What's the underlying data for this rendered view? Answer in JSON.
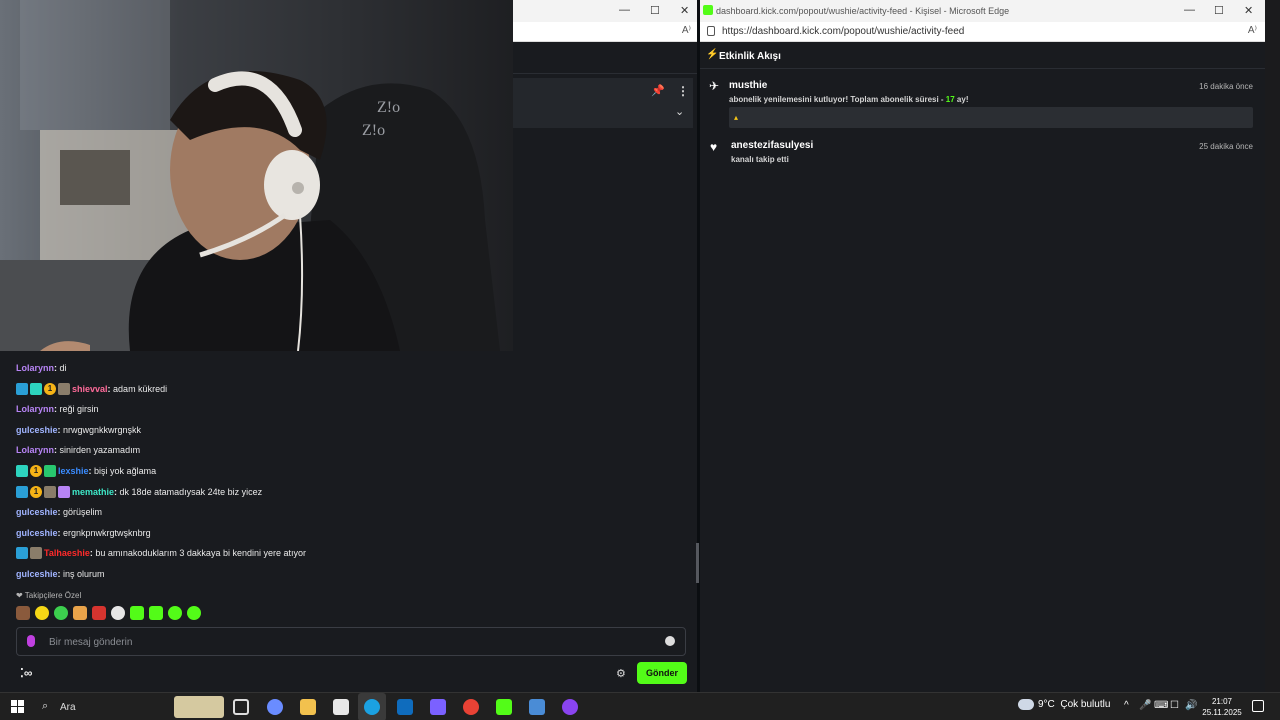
{
  "left_window": {
    "controls": [
      "—",
      "☐",
      "✕"
    ],
    "address_icon": "A⁾"
  },
  "pinned": {
    "pin_icon": "pin-icon",
    "more_icon": "⋮",
    "chevron": "⌄"
  },
  "chat": {
    "messages": [
      {
        "user": "Lolarynn",
        "color": "#b784f5",
        "text": "di"
      },
      {
        "user": "shievval",
        "color": "#ff6b9a",
        "text": "adam kükredi"
      },
      {
        "user": "Lolarynn",
        "color": "#b784f5",
        "text": "reği girsin"
      },
      {
        "user": "gulceshie",
        "color": "#a0b4ff",
        "text": "nrwgwgnkkwrgnşkk"
      },
      {
        "user": "Lolarynn",
        "color": "#b784f5",
        "text": "sinirden yazamadım"
      },
      {
        "user": "lexshie",
        "color": "#3a8cff",
        "text": "bişi yok ağlama"
      },
      {
        "user": "memathie",
        "color": "#3ee8c8",
        "text": "dk 18de atamadıysak 24te biz yicez"
      },
      {
        "user": "gulceshie",
        "color": "#a0b4ff",
        "text": "görüşelim"
      },
      {
        "user": "gulceshie",
        "color": "#a0b4ff",
        "text": "ergnkpnwkrgtwşknbrg"
      },
      {
        "user": "Talhaeshie",
        "color": "#ff2a2a",
        "text": "bu amınakoduklarım 3 dakkaya bi kendini yere atıyor"
      },
      {
        "user": "gulceshie",
        "color": "#a0b4ff",
        "text": "inş olurum"
      }
    ],
    "separator": ":",
    "gold_badge": "1",
    "emote_header": "❤ Takipçilere Özel",
    "input_placeholder": "Bir mesaj gönderin",
    "footer_left": "⁚∞",
    "settings_icon": "⚙",
    "send_label": "Gönder"
  },
  "edge": {
    "tab_title": "dashboard.kick.com/popout/wushie/activity-feed - Kişisel - Microsoft Edge",
    "controls": [
      "—",
      "☐",
      "✕"
    ],
    "url": "https://dashboard.kick.com/popout/wushie/activity-feed",
    "read_aloud": "A⁾",
    "feed_title": "Etkinlik Akışı",
    "feed_icon": "⚡",
    "events": [
      {
        "user": "musthie",
        "time": "16 dakika önce",
        "msg_before": "abonelik yenilemesini kutluyor! Toplam abonelik süresi - ",
        "msg_hl": "17",
        "msg_after": " ay!",
        "icon": "✈",
        "box_emote": "▴"
      },
      {
        "user": "anestezifasulyesi",
        "time": "25 dakika önce",
        "msg": "kanalı takip etti",
        "icon": "♥"
      }
    ]
  },
  "taskbar": {
    "search_label": "Ara",
    "search_icon": "⌕",
    "weather_temp": "9°C",
    "weather_text": "Çok bulutlu",
    "tray_icons": [
      "^",
      "🎤",
      "⌨",
      "☐",
      "🔊"
    ],
    "time": "21:07",
    "date": "25.11.2025"
  }
}
